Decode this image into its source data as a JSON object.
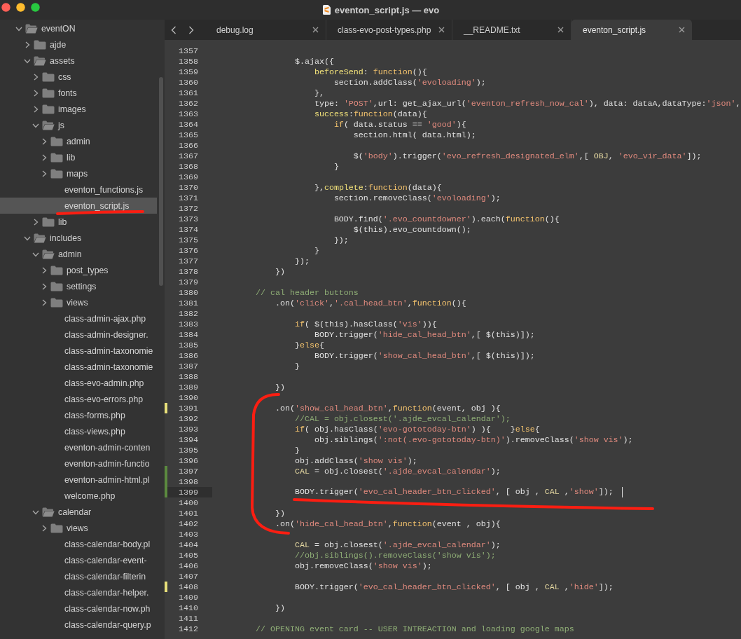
{
  "window": {
    "title": "eventon_script.js — evo"
  },
  "tabs": [
    {
      "label": "debug.log",
      "selected": false
    },
    {
      "label": "class-evo-post-types.php",
      "selected": false
    },
    {
      "label": "__README.txt",
      "selected": false
    },
    {
      "label": "eventon_script.js",
      "selected": true
    }
  ],
  "sidebar": {
    "tree": [
      {
        "label": "eventON",
        "kind": "folder",
        "expanded": true,
        "selected": false,
        "children": [
          {
            "label": "ajde",
            "kind": "folder",
            "expanded": false,
            "selected": false
          },
          {
            "label": "assets",
            "kind": "folder",
            "expanded": true,
            "selected": false,
            "children": [
              {
                "label": "css",
                "kind": "folder",
                "expanded": false,
                "selected": false
              },
              {
                "label": "fonts",
                "kind": "folder",
                "expanded": false,
                "selected": false
              },
              {
                "label": "images",
                "kind": "folder",
                "expanded": false,
                "selected": false
              },
              {
                "label": "js",
                "kind": "folder",
                "expanded": true,
                "selected": false,
                "children": [
                  {
                    "label": "admin",
                    "kind": "folder",
                    "expanded": false,
                    "selected": false
                  },
                  {
                    "label": "lib",
                    "kind": "folder",
                    "expanded": false,
                    "selected": false
                  },
                  {
                    "label": "maps",
                    "kind": "folder",
                    "expanded": false,
                    "selected": false
                  },
                  {
                    "label": "eventon_functions.js",
                    "kind": "file",
                    "selected": false
                  },
                  {
                    "label": "eventon_script.js",
                    "kind": "file",
                    "selected": true
                  }
                ]
              },
              {
                "label": "lib",
                "kind": "folder",
                "expanded": false,
                "selected": false
              }
            ]
          },
          {
            "label": "includes",
            "kind": "folder",
            "expanded": true,
            "selected": false,
            "children": [
              {
                "label": "admin",
                "kind": "folder",
                "expanded": true,
                "selected": false,
                "children": [
                  {
                    "label": "post_types",
                    "kind": "folder",
                    "expanded": false,
                    "selected": false
                  },
                  {
                    "label": "settings",
                    "kind": "folder",
                    "expanded": false,
                    "selected": false
                  },
                  {
                    "label": "views",
                    "kind": "folder",
                    "expanded": false,
                    "selected": false
                  },
                  {
                    "label": "class-admin-ajax.php",
                    "kind": "file",
                    "selected": false
                  },
                  {
                    "label": "class-admin-designer.",
                    "kind": "file",
                    "selected": false
                  },
                  {
                    "label": "class-admin-taxonomie",
                    "kind": "file",
                    "selected": false
                  },
                  {
                    "label": "class-admin-taxonomie",
                    "kind": "file",
                    "selected": false
                  },
                  {
                    "label": "class-evo-admin.php",
                    "kind": "file",
                    "selected": false
                  },
                  {
                    "label": "class-evo-errors.php",
                    "kind": "file",
                    "selected": false
                  },
                  {
                    "label": "class-forms.php",
                    "kind": "file",
                    "selected": false
                  },
                  {
                    "label": "class-views.php",
                    "kind": "file",
                    "selected": false
                  },
                  {
                    "label": "eventon-admin-conten",
                    "kind": "file",
                    "selected": false
                  },
                  {
                    "label": "eventon-admin-functio",
                    "kind": "file",
                    "selected": false
                  },
                  {
                    "label": "eventon-admin-html.pl",
                    "kind": "file",
                    "selected": false
                  },
                  {
                    "label": "welcome.php",
                    "kind": "file",
                    "selected": false
                  }
                ]
              },
              {
                "label": "calendar",
                "kind": "folder",
                "expanded": true,
                "selected": false,
                "children": [
                  {
                    "label": "views",
                    "kind": "folder",
                    "expanded": false,
                    "selected": false
                  },
                  {
                    "label": "class-calendar-body.pl",
                    "kind": "file",
                    "selected": false
                  },
                  {
                    "label": "class-calendar-event-",
                    "kind": "file",
                    "selected": false
                  },
                  {
                    "label": "class-calendar-filterin",
                    "kind": "file",
                    "selected": false
                  },
                  {
                    "label": "class-calendar-helper.",
                    "kind": "file",
                    "selected": false
                  },
                  {
                    "label": "class-calendar-now.ph",
                    "kind": "file",
                    "selected": false
                  },
                  {
                    "label": "class-calendar-query.p",
                    "kind": "file",
                    "selected": false
                  }
                ]
              }
            ]
          }
        ]
      }
    ]
  },
  "editor": {
    "lines": [
      {
        "number": "1357",
        "current": false
      },
      {
        "number": "1358",
        "current": false,
        "tokens": [
          {
            "kind": "plain",
            "text": "                $.ajax({"
          }
        ]
      },
      {
        "number": "1359",
        "current": false,
        "tokens": [
          {
            "kind": "property",
            "text": "                    beforeSend"
          },
          {
            "kind": "plain",
            "text": ": "
          },
          {
            "kind": "keyword",
            "text": "function"
          },
          {
            "kind": "plain",
            "text": "(){"
          }
        ]
      },
      {
        "number": "1360",
        "current": false,
        "tokens": [
          {
            "kind": "plain",
            "text": "                        section.addClass("
          },
          {
            "kind": "string",
            "text": "'evoloading'"
          },
          {
            "kind": "plain",
            "text": ");"
          }
        ]
      },
      {
        "number": "1361",
        "current": false,
        "tokens": [
          {
            "kind": "plain",
            "text": "                    },"
          }
        ]
      },
      {
        "number": "1362",
        "current": false,
        "tokens": [
          {
            "kind": "plain",
            "text": "                    type: "
          },
          {
            "kind": "string",
            "text": "'POST'"
          },
          {
            "kind": "plain",
            "text": ",url: get_ajax_url("
          },
          {
            "kind": "string",
            "text": "'eventon_refresh_now_cal'"
          },
          {
            "kind": "plain",
            "text": "), data: dataA,dataType:"
          },
          {
            "kind": "string",
            "text": "'json'"
          },
          {
            "kind": "plain",
            "text": ","
          }
        ]
      },
      {
        "number": "1363",
        "current": false,
        "tokens": [
          {
            "kind": "property",
            "text": "                    success"
          },
          {
            "kind": "plain",
            "text": ":"
          },
          {
            "kind": "keyword",
            "text": "function"
          },
          {
            "kind": "plain",
            "text": "(data){"
          }
        ]
      },
      {
        "number": "1364",
        "current": false,
        "tokens": [
          {
            "kind": "keyword",
            "text": "                        if"
          },
          {
            "kind": "plain",
            "text": "( data.status == "
          },
          {
            "kind": "string",
            "text": "'good'"
          },
          {
            "kind": "plain",
            "text": "){"
          }
        ]
      },
      {
        "number": "1365",
        "current": false,
        "tokens": [
          {
            "kind": "plain",
            "text": "                            section.html( data.html);"
          }
        ]
      },
      {
        "number": "1366",
        "current": false
      },
      {
        "number": "1367",
        "current": false,
        "tokens": [
          {
            "kind": "plain",
            "text": "                            $("
          },
          {
            "kind": "string",
            "text": "'body'"
          },
          {
            "kind": "plain",
            "text": ").trigger("
          },
          {
            "kind": "string",
            "text": "'evo_refresh_designated_elm'"
          },
          {
            "kind": "plain",
            "text": ",[ "
          },
          {
            "kind": "constant",
            "text": "OBJ"
          },
          {
            "kind": "plain",
            "text": ", "
          },
          {
            "kind": "string",
            "text": "'evo_vir_data'"
          },
          {
            "kind": "plain",
            "text": "]);"
          }
        ]
      },
      {
        "number": "1368",
        "current": false,
        "tokens": [
          {
            "kind": "plain",
            "text": "                        }"
          }
        ]
      },
      {
        "number": "1369",
        "current": false
      },
      {
        "number": "1370",
        "current": false,
        "tokens": [
          {
            "kind": "plain",
            "text": "                    },"
          },
          {
            "kind": "property",
            "text": "complete"
          },
          {
            "kind": "plain",
            "text": ":"
          },
          {
            "kind": "keyword",
            "text": "function"
          },
          {
            "kind": "plain",
            "text": "(data){"
          }
        ]
      },
      {
        "number": "1371",
        "current": false,
        "tokens": [
          {
            "kind": "plain",
            "text": "                        section.removeClass("
          },
          {
            "kind": "string",
            "text": "'evoloading'"
          },
          {
            "kind": "plain",
            "text": ");"
          }
        ]
      },
      {
        "number": "1372",
        "current": false
      },
      {
        "number": "1373",
        "current": false,
        "tokens": [
          {
            "kind": "plain",
            "text": "                        BODY.find("
          },
          {
            "kind": "string",
            "text": "'.evo_countdowner'"
          },
          {
            "kind": "plain",
            "text": ").each("
          },
          {
            "kind": "keyword",
            "text": "function"
          },
          {
            "kind": "plain",
            "text": "(){"
          }
        ]
      },
      {
        "number": "1374",
        "current": false,
        "tokens": [
          {
            "kind": "plain",
            "text": "                            $(this).evo_countdown();"
          }
        ]
      },
      {
        "number": "1375",
        "current": false,
        "tokens": [
          {
            "kind": "plain",
            "text": "                        });"
          }
        ]
      },
      {
        "number": "1376",
        "current": false,
        "tokens": [
          {
            "kind": "plain",
            "text": "                    }"
          }
        ]
      },
      {
        "number": "1377",
        "current": false,
        "tokens": [
          {
            "kind": "plain",
            "text": "                });"
          }
        ]
      },
      {
        "number": "1378",
        "current": false,
        "tokens": [
          {
            "kind": "plain",
            "text": "            })"
          }
        ]
      },
      {
        "number": "1379",
        "current": false
      },
      {
        "number": "1380",
        "current": false,
        "tokens": [
          {
            "kind": "comment",
            "text": "        // cal header buttons"
          }
        ]
      },
      {
        "number": "1381",
        "current": false,
        "tokens": [
          {
            "kind": "plain",
            "text": "            .on("
          },
          {
            "kind": "string",
            "text": "'click'"
          },
          {
            "kind": "plain",
            "text": ","
          },
          {
            "kind": "string",
            "text": "'.cal_head_btn'"
          },
          {
            "kind": "plain",
            "text": ","
          },
          {
            "kind": "keyword",
            "text": "function"
          },
          {
            "kind": "plain",
            "text": "(){"
          }
        ]
      },
      {
        "number": "1382",
        "current": false
      },
      {
        "number": "1383",
        "current": false,
        "tokens": [
          {
            "kind": "keyword",
            "text": "                if"
          },
          {
            "kind": "plain",
            "text": "( $(this).hasClass("
          },
          {
            "kind": "string",
            "text": "'vis'"
          },
          {
            "kind": "plain",
            "text": ")){"
          }
        ]
      },
      {
        "number": "1384",
        "current": false,
        "tokens": [
          {
            "kind": "plain",
            "text": "                    BODY.trigger("
          },
          {
            "kind": "string",
            "text": "'hide_cal_head_btn'"
          },
          {
            "kind": "plain",
            "text": ",[ $(this)]);"
          }
        ]
      },
      {
        "number": "1385",
        "current": false,
        "tokens": [
          {
            "kind": "plain",
            "text": "                }"
          },
          {
            "kind": "keyword",
            "text": "else"
          },
          {
            "kind": "plain",
            "text": "{"
          }
        ]
      },
      {
        "number": "1386",
        "current": false,
        "tokens": [
          {
            "kind": "plain",
            "text": "                    BODY.trigger("
          },
          {
            "kind": "string",
            "text": "'show_cal_head_btn'"
          },
          {
            "kind": "plain",
            "text": ",[ $(this)]);"
          }
        ]
      },
      {
        "number": "1387",
        "current": false,
        "tokens": [
          {
            "kind": "plain",
            "text": "                }"
          }
        ]
      },
      {
        "number": "1388",
        "current": false
      },
      {
        "number": "1389",
        "current": false,
        "tokens": [
          {
            "kind": "plain",
            "text": "            })"
          }
        ]
      },
      {
        "number": "1390",
        "current": false
      },
      {
        "number": "1391",
        "current": false,
        "color": "#e8e07a",
        "tokens": [
          {
            "kind": "plain",
            "text": "            .on("
          },
          {
            "kind": "string",
            "text": "'show_cal_head_btn'"
          },
          {
            "kind": "plain",
            "text": ","
          },
          {
            "kind": "keyword",
            "text": "function"
          },
          {
            "kind": "plain",
            "text": "(event, obj ){"
          }
        ]
      },
      {
        "number": "1392",
        "current": false,
        "tokens": [
          {
            "kind": "comment",
            "text": "                //CAL = obj.closest('.ajde_evcal_calendar');"
          }
        ]
      },
      {
        "number": "1393",
        "current": false,
        "tokens": [
          {
            "kind": "keyword",
            "text": "                if"
          },
          {
            "kind": "plain",
            "text": "( obj.hasClass("
          },
          {
            "kind": "string",
            "text": "'evo-gototoday-btn'"
          },
          {
            "kind": "plain",
            "text": ") ){    }"
          },
          {
            "kind": "keyword",
            "text": "else"
          },
          {
            "kind": "plain",
            "text": "{"
          }
        ]
      },
      {
        "number": "1394",
        "current": false,
        "tokens": [
          {
            "kind": "plain",
            "text": "                    obj.siblings("
          },
          {
            "kind": "string",
            "text": "':not(.evo-gototoday-btn)'"
          },
          {
            "kind": "plain",
            "text": ").removeClass("
          },
          {
            "kind": "string",
            "text": "'show vis'"
          },
          {
            "kind": "plain",
            "text": ");"
          }
        ]
      },
      {
        "number": "1395",
        "current": false,
        "tokens": [
          {
            "kind": "plain",
            "text": "                }"
          }
        ]
      },
      {
        "number": "1396",
        "current": false,
        "tokens": [
          {
            "kind": "plain",
            "text": "                obj.addClass("
          },
          {
            "kind": "string",
            "text": "'show vis'"
          },
          {
            "kind": "plain",
            "text": ");"
          }
        ]
      },
      {
        "number": "1397",
        "current": false,
        "color": "#5b8a3f",
        "tokens": [
          {
            "kind": "constant",
            "text": "                CAL"
          },
          {
            "kind": "plain",
            "text": " = obj.closest("
          },
          {
            "kind": "string",
            "text": "'.ajde_evcal_calendar'"
          },
          {
            "kind": "plain",
            "text": ");"
          }
        ]
      },
      {
        "number": "1398",
        "current": false,
        "color": "#5b8a3f"
      },
      {
        "number": "1399",
        "current": true,
        "color": "#5b8a3f",
        "tokens": [
          {
            "kind": "plain",
            "text": "                BODY.trigger("
          },
          {
            "kind": "string",
            "text": "'evo_cal_header_btn_clicked'"
          },
          {
            "kind": "plain",
            "text": ", [ obj , "
          },
          {
            "kind": "constant",
            "text": "CAL"
          },
          {
            "kind": "plain",
            "text": " ,"
          },
          {
            "kind": "string",
            "text": "'show'"
          },
          {
            "kind": "plain",
            "text": "]);"
          }
        ]
      },
      {
        "number": "1400",
        "current": false
      },
      {
        "number": "1401",
        "current": false,
        "tokens": [
          {
            "kind": "plain",
            "text": "            })"
          }
        ]
      },
      {
        "number": "1402",
        "current": false,
        "tokens": [
          {
            "kind": "plain",
            "text": "            .on("
          },
          {
            "kind": "string",
            "text": "'hide_cal_head_btn'"
          },
          {
            "kind": "plain",
            "text": ","
          },
          {
            "kind": "keyword",
            "text": "function"
          },
          {
            "kind": "plain",
            "text": "(event , obj){"
          }
        ]
      },
      {
        "number": "1403",
        "current": false
      },
      {
        "number": "1404",
        "current": false,
        "tokens": [
          {
            "kind": "constant",
            "text": "                CAL"
          },
          {
            "kind": "plain",
            "text": " = obj.closest("
          },
          {
            "kind": "string",
            "text": "'.ajde_evcal_calendar'"
          },
          {
            "kind": "plain",
            "text": ");"
          }
        ]
      },
      {
        "number": "1405",
        "current": false,
        "tokens": [
          {
            "kind": "comment",
            "text": "                //obj.siblings().removeClass('show vis');"
          }
        ]
      },
      {
        "number": "1406",
        "current": false,
        "tokens": [
          {
            "kind": "plain",
            "text": "                obj.removeClass("
          },
          {
            "kind": "string",
            "text": "'show vis'"
          },
          {
            "kind": "plain",
            "text": ");"
          }
        ]
      },
      {
        "number": "1407",
        "current": false
      },
      {
        "number": "1408",
        "current": false,
        "color": "#e8e07a",
        "tokens": [
          {
            "kind": "plain",
            "text": "                BODY.trigger("
          },
          {
            "kind": "string",
            "text": "'evo_cal_header_btn_clicked'"
          },
          {
            "kind": "plain",
            "text": ", [ obj , "
          },
          {
            "kind": "constant",
            "text": "CAL"
          },
          {
            "kind": "plain",
            "text": " ,"
          },
          {
            "kind": "string",
            "text": "'hide'"
          },
          {
            "kind": "plain",
            "text": "]);"
          }
        ]
      },
      {
        "number": "1409",
        "current": false
      },
      {
        "number": "1410",
        "current": false,
        "tokens": [
          {
            "kind": "plain",
            "text": "            })"
          }
        ]
      },
      {
        "number": "1411",
        "current": false
      },
      {
        "number": "1412",
        "current": false,
        "tokens": [
          {
            "kind": "comment",
            "text": "        // OPENING event card -- USER INTREACTION and loading google maps"
          }
        ]
      }
    ]
  },
  "annotations": [
    {
      "kind": "file-underline"
    },
    {
      "kind": "code-bracket"
    },
    {
      "kind": "code-underline"
    }
  ]
}
